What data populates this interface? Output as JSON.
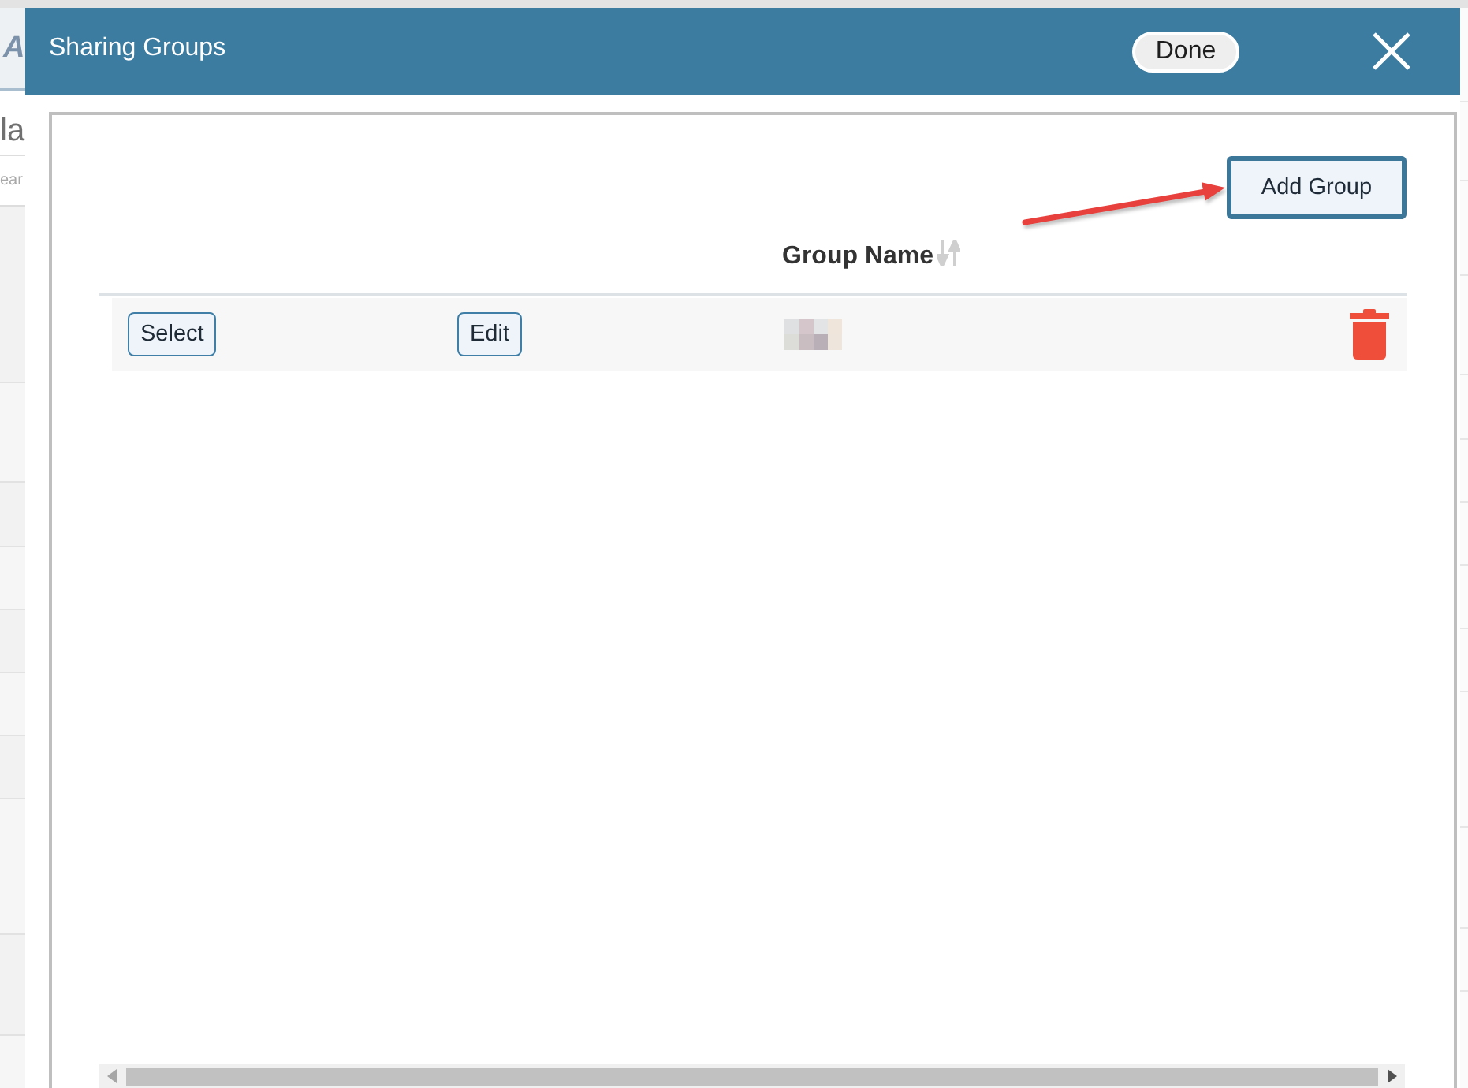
{
  "background_page": {
    "texts": [
      {
        "kind": "logo",
        "text": "A"
      },
      {
        "kind": "heading",
        "text": "la"
      },
      {
        "kind": "hint",
        "text": "ear"
      }
    ]
  },
  "dialog": {
    "title": "Sharing Groups",
    "done_label": "Done"
  },
  "panel": {
    "add_button": "Add Group",
    "table": {
      "column_3": {
        "label": "Group Name"
      },
      "rows": [
        {
          "select_label": "Select",
          "edit_label": "Edit"
        }
      ]
    }
  }
}
